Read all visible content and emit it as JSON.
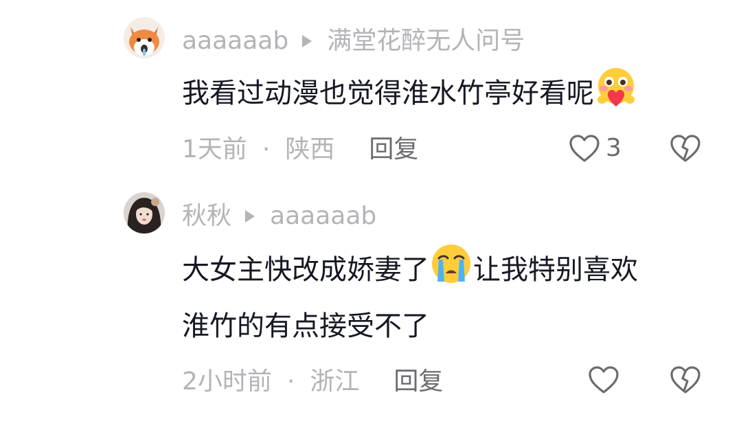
{
  "replies": [
    {
      "author": "aaaaaab",
      "reply_to": "满堂花醉无人问号",
      "text": "我看过动漫也觉得淮水竹亭好看呢",
      "text_line2": "",
      "emoji": "blushing-heart-emoji",
      "time": "1天前",
      "separator": "·",
      "location": "陕西",
      "reply_label": "回复",
      "like_count": "3",
      "avatar": "fox-avatar"
    },
    {
      "author": "秋秋",
      "reply_to": "aaaaaab",
      "text_part1": "大女主快改成娇妻了",
      "text_part2": "让我特别喜欢",
      "text_line2": "淮竹的有点接受不了",
      "emoji": "crying-emoji",
      "time": "2小时前",
      "separator": "·",
      "location": "浙江",
      "reply_label": "回复",
      "like_count": "",
      "avatar": "girl-avatar"
    }
  ],
  "colors": {
    "secondary_text": "#b3b3b8",
    "primary_text": "#161823",
    "action_text": "#6b6b70"
  }
}
